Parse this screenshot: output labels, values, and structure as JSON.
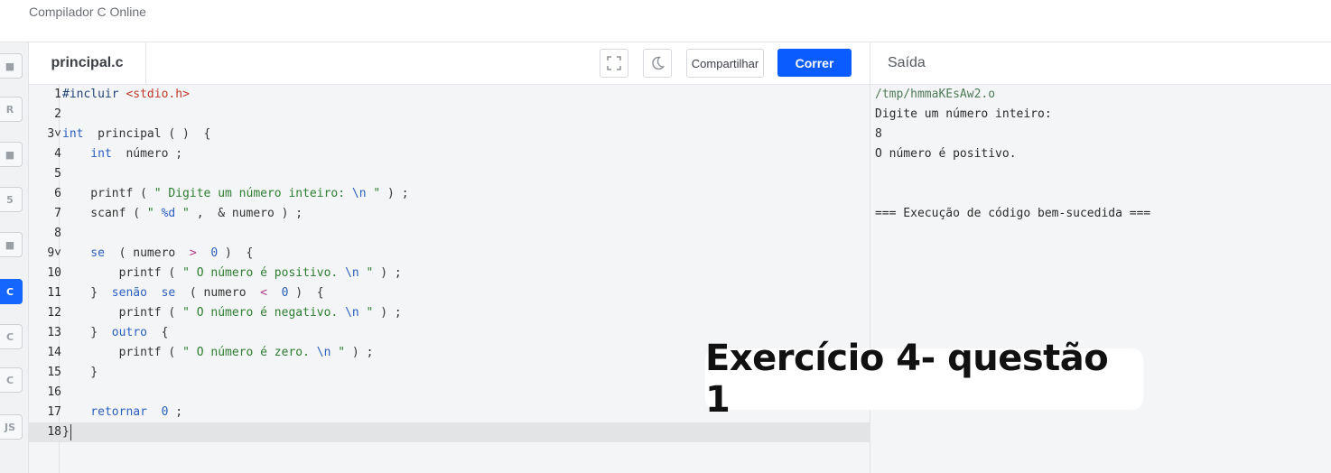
{
  "app": {
    "title": "Compilador C Online"
  },
  "languages": [
    {
      "name": "python-icon",
      "label": "",
      "active": false
    },
    {
      "name": "r-lang-icon",
      "label": "R",
      "active": false
    },
    {
      "name": "database-icon",
      "label": "",
      "active": false
    },
    {
      "name": "html5-icon",
      "label": "5",
      "active": false
    },
    {
      "name": "java-icon",
      "label": "",
      "active": false
    },
    {
      "name": "c-lang-icon",
      "label": "C",
      "active": true
    },
    {
      "name": "cpp-icon",
      "label": "C",
      "active": false
    },
    {
      "name": "csharp-icon",
      "label": "C",
      "active": false
    },
    {
      "name": "javascript-icon",
      "label": "JS",
      "active": false
    }
  ],
  "editor": {
    "file_tab": "principal.c",
    "share_label": "Compartilhar",
    "run_label": "Correr",
    "active_line": 18,
    "lines": [
      {
        "n": "1",
        "tokens": [
          [
            "#incluir ",
            "#24427a"
          ],
          [
            "<stdio.h>",
            "#c0392b"
          ]
        ]
      },
      {
        "n": "2",
        "tokens": []
      },
      {
        "n": "3",
        "fold": true,
        "tokens": [
          [
            "int",
            "#2c5fbf"
          ],
          [
            "  principal ( )  {",
            "#333333"
          ]
        ]
      },
      {
        "n": "4",
        "tokens": [
          [
            "    int",
            "#2c5fbf"
          ],
          [
            "  número ;",
            "#333333"
          ]
        ]
      },
      {
        "n": "5",
        "tokens": []
      },
      {
        "n": "6",
        "tokens": [
          [
            "    printf ( ",
            "#333333"
          ],
          [
            "\" Digite um número inteiro: ",
            "#2e7d32"
          ],
          [
            "\\n",
            "#2c5fbf"
          ],
          [
            " \"",
            "#2e7d32"
          ],
          [
            " ) ;",
            "#333333"
          ]
        ]
      },
      {
        "n": "7",
        "tokens": [
          [
            "    scanf ( ",
            "#333333"
          ],
          [
            "\" ",
            "#2e7d32"
          ],
          [
            "%d",
            "#2c5fbf"
          ],
          [
            " \"",
            "#2e7d32"
          ],
          [
            " ,  & numero ) ;",
            "#333333"
          ]
        ]
      },
      {
        "n": "8",
        "tokens": []
      },
      {
        "n": "9",
        "fold": true,
        "tokens": [
          [
            "    se",
            "#2c5fbf"
          ],
          [
            "  ( numero  ",
            "#333333"
          ],
          [
            ">",
            "#b03a8c"
          ],
          [
            "  ",
            "#333333"
          ],
          [
            "0",
            "#2c5fbf"
          ],
          [
            " )  {",
            "#333333"
          ]
        ]
      },
      {
        "n": "10",
        "tokens": [
          [
            "        printf ( ",
            "#333333"
          ],
          [
            "\" O número é positivo. ",
            "#2e7d32"
          ],
          [
            "\\n",
            "#2c5fbf"
          ],
          [
            " \"",
            "#2e7d32"
          ],
          [
            " ) ;",
            "#333333"
          ]
        ]
      },
      {
        "n": "11",
        "tokens": [
          [
            "    }  ",
            "#333333"
          ],
          [
            "senão  se",
            "#2c5fbf"
          ],
          [
            "  ( numero  ",
            "#333333"
          ],
          [
            "<",
            "#b03a8c"
          ],
          [
            "  ",
            "#333333"
          ],
          [
            "0",
            "#2c5fbf"
          ],
          [
            " )  {",
            "#333333"
          ]
        ]
      },
      {
        "n": "12",
        "tokens": [
          [
            "        printf ( ",
            "#333333"
          ],
          [
            "\" O número é negativo. ",
            "#2e7d32"
          ],
          [
            "\\n",
            "#2c5fbf"
          ],
          [
            " \"",
            "#2e7d32"
          ],
          [
            " ) ;",
            "#333333"
          ]
        ]
      },
      {
        "n": "13",
        "tokens": [
          [
            "    }  ",
            "#333333"
          ],
          [
            "outro",
            "#2c5fbf"
          ],
          [
            "  {",
            "#333333"
          ]
        ]
      },
      {
        "n": "14",
        "tokens": [
          [
            "        printf ( ",
            "#333333"
          ],
          [
            "\" O número é zero. ",
            "#2e7d32"
          ],
          [
            "\\n",
            "#2c5fbf"
          ],
          [
            " \"",
            "#2e7d32"
          ],
          [
            " ) ;",
            "#333333"
          ]
        ]
      },
      {
        "n": "15",
        "tokens": [
          [
            "    }",
            "#333333"
          ]
        ]
      },
      {
        "n": "16",
        "tokens": []
      },
      {
        "n": "17",
        "tokens": [
          [
            "    retornar",
            "#2c5fbf"
          ],
          [
            "  ",
            "#333333"
          ],
          [
            "0",
            "#2c5fbf"
          ],
          [
            " ;",
            "#333333"
          ]
        ]
      },
      {
        "n": "18",
        "tokens": [
          [
            "}",
            "#333333"
          ]
        ]
      }
    ]
  },
  "output": {
    "title": "Saída",
    "lines": [
      {
        "text": "/tmp/hmmaKEsAw2.o",
        "kind": "path"
      },
      {
        "text": "Digite um número inteiro:",
        "kind": "normal"
      },
      {
        "text": "8",
        "kind": "normal"
      },
      {
        "text": "O número é positivo.",
        "kind": "normal"
      },
      {
        "text": "",
        "kind": "normal"
      },
      {
        "text": "",
        "kind": "normal"
      },
      {
        "text": "=== Execução de código bem-sucedida ===",
        "kind": "normal"
      }
    ]
  },
  "overlay": {
    "caption": "Exercício 4- questão 1"
  }
}
